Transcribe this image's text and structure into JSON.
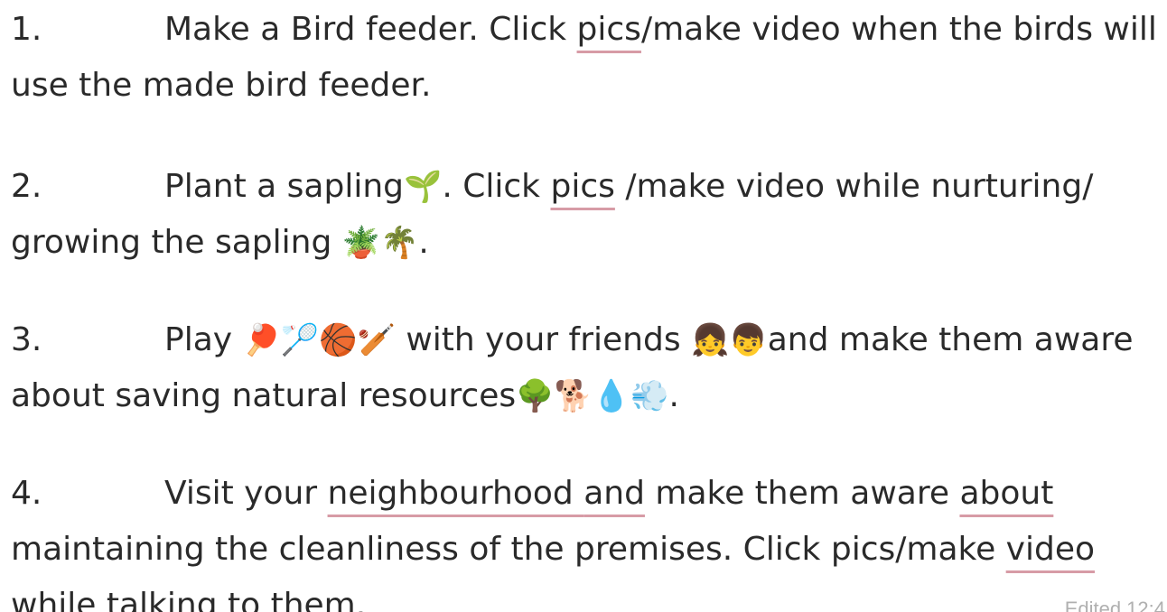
{
  "message": {
    "items": [
      {
        "number": "1.",
        "text_a": "Make a Bird feeder. Click ",
        "underlined": "pics",
        "text_b": "/make video when the birds will use the made bird feeder."
      },
      {
        "number": "2.",
        "text_a": "Plant a sapling",
        "emoji_a": "🌱",
        "text_b": ". Click ",
        "underlined": "pics",
        "text_c": " /make video while nurturing/ growing the sapling ",
        "emoji_b": "🪴🌴",
        "text_d": "."
      },
      {
        "number": "3.",
        "text_a": "Play ",
        "emoji_a": "🏓🏸🏀🏏",
        "text_b": " with your friends ",
        "emoji_b": "👧👦",
        "text_c": "and make them aware about saving natural resources",
        "emoji_c": "🌳🐕💧💨",
        "text_d": "."
      },
      {
        "number": "4.",
        "text_a": "Visit your ",
        "underlined_a": "neighbourhood ",
        "text_b": " ",
        "underlined_b": "and",
        "text_c": " make them aware ",
        "underlined_c": "about",
        "text_d": " maintaining the cleanliness of the premises. Click pics/make ",
        "underlined_d": "video",
        "text_e": " while talking to them."
      }
    ],
    "edited_label": "Edited 12:4"
  },
  "colors": {
    "text": "#2a2a2a",
    "spellcheck_underline": "#d79ba6",
    "edited": "#b0b0b0",
    "background": "#ffffff"
  }
}
